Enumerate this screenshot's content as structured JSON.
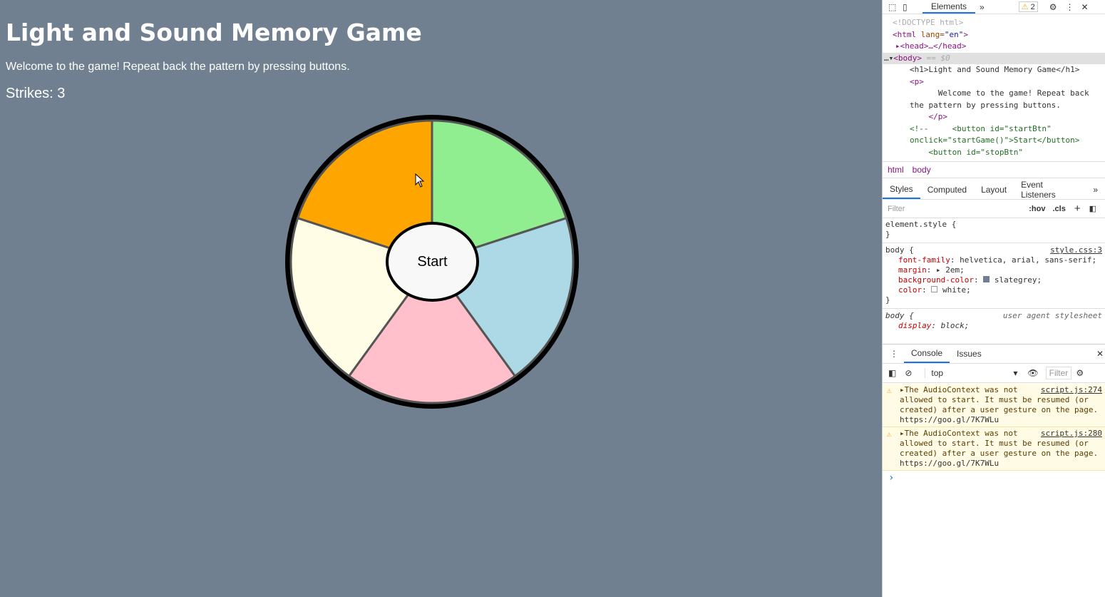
{
  "page": {
    "title": "Light and Sound Memory Game",
    "intro": "Welcome to the game! Repeat back the pattern by pressing buttons.",
    "strikes": "Strikes: 3",
    "start_label": "Start",
    "segments": [
      {
        "name": "green",
        "color": "#90ee90"
      },
      {
        "name": "blue",
        "color": "#add8e6"
      },
      {
        "name": "pink",
        "color": "#ffc0cb"
      },
      {
        "name": "yellow",
        "color": "#fffde6"
      },
      {
        "name": "orange",
        "color": "#ffa500"
      }
    ]
  },
  "devtools": {
    "top_tabs": {
      "elements": "Elements",
      "more": "»",
      "warnings": "2"
    },
    "dom": {
      "l1": "<!DOCTYPE html>",
      "l2_tag": "<html",
      "l2_attr": " lang=",
      "l2_val": "\"en\"",
      "l2_end": ">",
      "l3": "<head>…</head>",
      "l4": "<body>",
      "l4_sel": " == $0",
      "l5": "<h1>Light and Sound Memory Game</h1>",
      "l6": "<p>",
      "l7": "      Welcome to the game! Repeat back",
      "l8": "the pattern by pressing buttons.",
      "l9": "    </p>",
      "l10": "<!--     <button id=\"startBtn\"",
      "l11": "onclick=\"startGame()\">Start</button>",
      "l12": "    <button id=\"stopBtn\""
    },
    "breadcrumb": [
      "html",
      "body"
    ],
    "style_tabs": [
      "Styles",
      "Computed",
      "Layout",
      "Event Listeners",
      "»"
    ],
    "filter_placeholder": "Filter",
    "hov": ":hov",
    "cls": ".cls",
    "plus": "+",
    "rules": {
      "element_style": "element.style {",
      "close": "}",
      "body_sel": "body {",
      "body_src": "style.css:3",
      "decls": [
        {
          "p": "font-family",
          "v": " helvetica, arial, sans-serif;"
        },
        {
          "p": "margin",
          "v": " ▸ 2em;"
        },
        {
          "p": "background-color",
          "v": " slategrey;"
        },
        {
          "p": "color",
          "v": " white;"
        }
      ],
      "ua_sel": "body {",
      "ua_src": "user agent stylesheet",
      "ua_decl_p": "display",
      "ua_decl_v": " block;"
    },
    "console_tabs": [
      "Console",
      "Issues"
    ],
    "context": "top",
    "console_filter": "Filter",
    "messages": [
      {
        "text": "▸The AudioContext was not allowed to start. It must be resumed (or created) after a user gesture on the page.",
        "src": "script.js:274",
        "link": "https://goo.gl/7K7WLu"
      },
      {
        "text": "▸The AudioContext was not allowed to start. It must be resumed (or created) after a user gesture on the page.",
        "src": "script.js:280",
        "link": "https://goo.gl/7K7WLu"
      }
    ],
    "prompt": "›"
  }
}
